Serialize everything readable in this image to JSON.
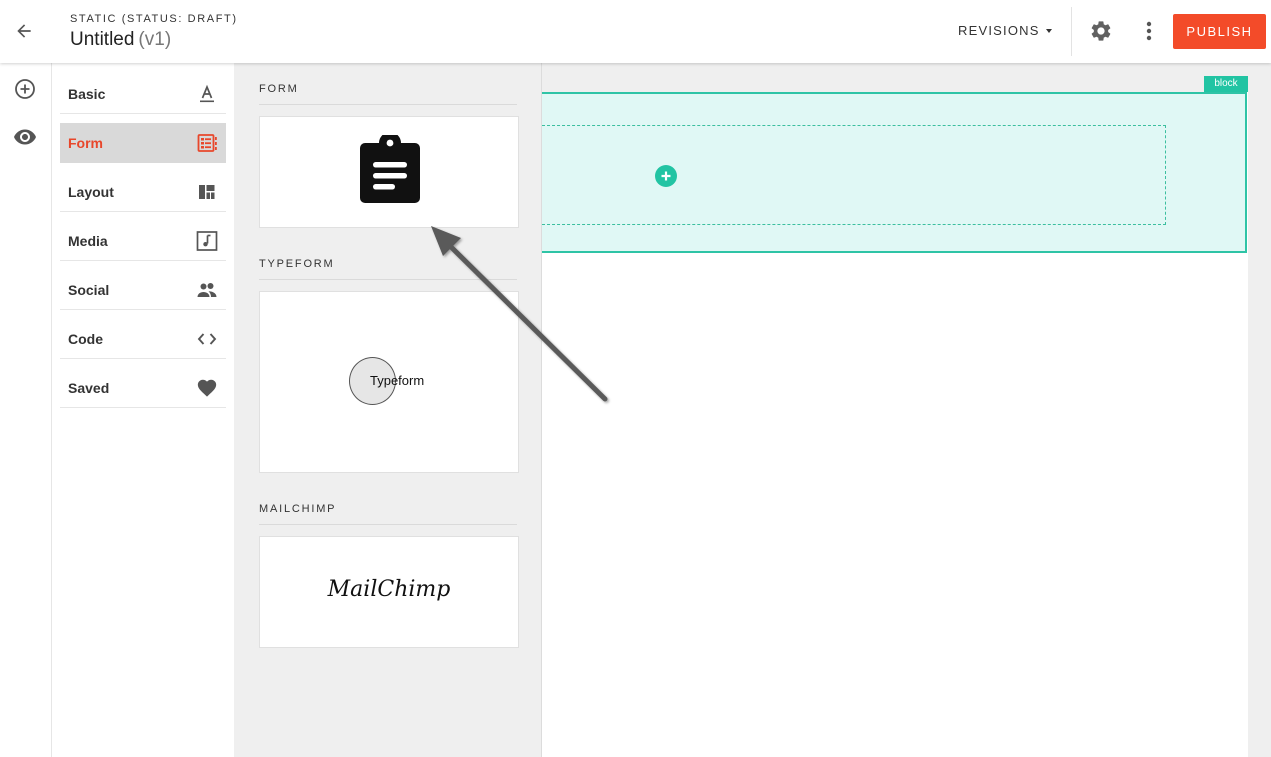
{
  "header": {
    "subtitle": "STATIC (STATUS: DRAFT)",
    "title": "Untitled",
    "version": "(v1)",
    "revisions_label": "REVISIONS",
    "publish_label": "PUBLISH"
  },
  "sidebar": {
    "items": [
      {
        "label": "Basic",
        "icon": "text-format-icon",
        "active": false
      },
      {
        "label": "Form",
        "icon": "form-icon",
        "active": true
      },
      {
        "label": "Layout",
        "icon": "layout-icon",
        "active": false
      },
      {
        "label": "Media",
        "icon": "media-icon",
        "active": false
      },
      {
        "label": "Social",
        "icon": "people-icon",
        "active": false
      },
      {
        "label": "Code",
        "icon": "code-icon",
        "active": false
      },
      {
        "label": "Saved",
        "icon": "heart-icon",
        "active": false
      }
    ]
  },
  "panel": {
    "sections": [
      {
        "title": "FORM",
        "card": "clipboard-icon"
      },
      {
        "title": "TYPEFORM",
        "card": "Typeform"
      },
      {
        "title": "MAILCHIMP",
        "card": "MailChimp"
      }
    ]
  },
  "canvas": {
    "block_tag": "block"
  },
  "colors": {
    "accent": "#f34b29",
    "active_text": "#e8472b",
    "teal": "#22c4a3",
    "block_bg": "#e0f8f5"
  }
}
